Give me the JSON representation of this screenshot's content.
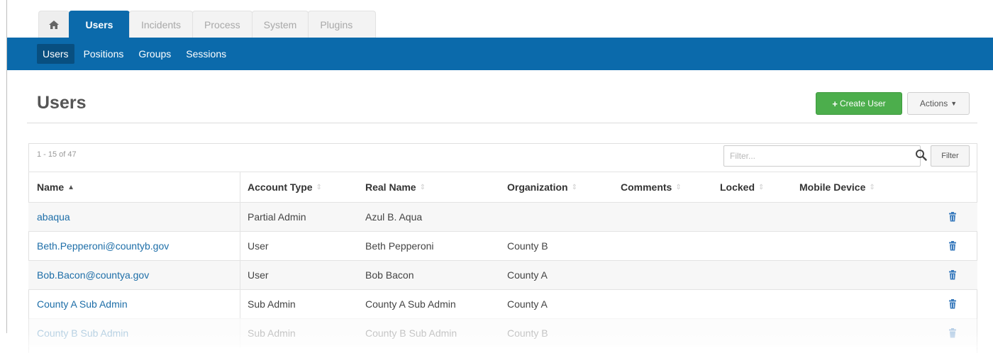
{
  "tabs": {
    "home_icon": "home-icon",
    "items": [
      {
        "label": "Users",
        "active": true
      },
      {
        "label": "Incidents",
        "active": false
      },
      {
        "label": "Process",
        "active": false
      },
      {
        "label": "System",
        "active": false
      },
      {
        "label": "Plugins",
        "active": false
      }
    ]
  },
  "subnav": {
    "items": [
      {
        "label": "Users",
        "active": true
      },
      {
        "label": "Positions",
        "active": false
      },
      {
        "label": "Groups",
        "active": false
      },
      {
        "label": "Sessions",
        "active": false
      }
    ]
  },
  "header": {
    "title": "Users",
    "create_label": "Create User",
    "actions_label": "Actions"
  },
  "list": {
    "count": "1 - 15 of 47",
    "filter_placeholder": "Filter...",
    "filter_button": "Filter"
  },
  "table": {
    "columns": [
      "Name",
      "Account Type",
      "Real Name",
      "Organization",
      "Comments",
      "Locked",
      "Mobile Device"
    ],
    "sort": {
      "column": "Name",
      "direction": "ascending"
    },
    "rows": [
      {
        "name": "abaqua",
        "account_type": "Partial Admin",
        "real_name": "Azul B. Aqua",
        "organization": "",
        "comments": "",
        "locked": "",
        "mobile_device": ""
      },
      {
        "name": "Beth.Pepperoni@countyb.gov",
        "account_type": "User",
        "real_name": "Beth Pepperoni",
        "organization": "County B",
        "comments": "",
        "locked": "",
        "mobile_device": ""
      },
      {
        "name": "Bob.Bacon@countya.gov",
        "account_type": "User",
        "real_name": "Bob Bacon",
        "organization": "County A",
        "comments": "",
        "locked": "",
        "mobile_device": ""
      },
      {
        "name": "County A Sub Admin",
        "account_type": "Sub Admin",
        "real_name": "County A Sub Admin",
        "organization": "County A",
        "comments": "",
        "locked": "",
        "mobile_device": ""
      },
      {
        "name": "County B Sub Admin",
        "account_type": "Sub Admin",
        "real_name": "County B Sub Admin",
        "organization": "County B",
        "comments": "",
        "locked": "",
        "mobile_device": ""
      }
    ]
  },
  "colors": {
    "brand_blue": "#0b6aab",
    "create_green": "#4cae4c",
    "link_blue": "#1d6ea8"
  }
}
